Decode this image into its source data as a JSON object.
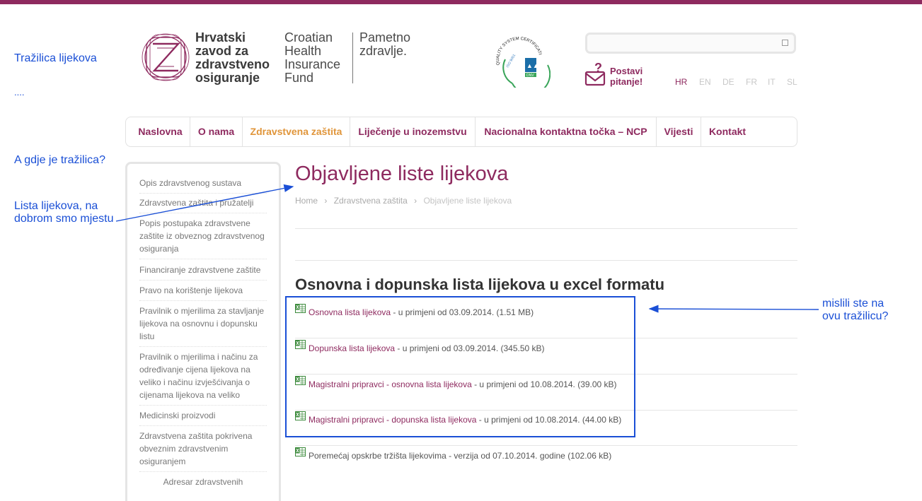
{
  "annotations": {
    "search_label": "Tražilica lijekova",
    "dots": "....",
    "where_search": "A gdje je tražilica?",
    "list_line1": "Lista lijekova, na",
    "list_line2": "dobrom smo mjestu",
    "meant_line1": "mislili ste na",
    "meant_line2": "ovu tražilicu?"
  },
  "logo": {
    "hr_lines": [
      "Hrvatski",
      "zavod za",
      "zdravstveno",
      "osiguranje"
    ],
    "en_lines": [
      "Croatian",
      "Health",
      "Insurance",
      "Fund"
    ],
    "slogan_lines": [
      "Pametno",
      "zdravlje."
    ]
  },
  "certificate": {
    "text_top": "QUALITY SYSTEM CERTIFICATION",
    "text_iso": "ISO 9001",
    "text_dnv": "DNV"
  },
  "search": {
    "value": "",
    "placeholder": ""
  },
  "ask": {
    "line1": "Postavi",
    "line2": "pitanje!"
  },
  "languages": [
    "HR",
    "EN",
    "DE",
    "FR",
    "IT",
    "SL"
  ],
  "nav": [
    "Naslovna",
    "O nama",
    "Zdravstvena zaštita",
    "Liječenje u inozemstvu",
    "Nacionalna kontaktna točka – NCP",
    "Vijesti",
    "Kontakt"
  ],
  "sidebar": [
    [
      "Opis zdravstvenog sustava"
    ],
    [
      "Zdravstvena zaštita i pružatelji"
    ],
    [
      "Popis postupaka zdravstvene",
      "zaštite iz obveznog zdravstvenog",
      "osiguranja"
    ],
    [
      "Financiranje zdravstvene zaštite"
    ],
    [
      "Pravo na korištenje lijekova"
    ],
    [
      "Pravilnik o mjerilima za stavljanje",
      "lijekova na osnovnu i dopunsku",
      "listu"
    ],
    [
      "Pravilnik o mjerilima i načinu za",
      "određivanje cijena lijekova na",
      "veliko i načinu izvješćivanja o",
      "cijenama lijekova na veliko"
    ],
    [
      "Medicinski proizvodi"
    ],
    [
      "Zdravstvena zaštita pokrivena",
      "obveznim zdravstvenim",
      "osiguranjem"
    ],
    [
      "Adresar zdravstvenih"
    ]
  ],
  "main": {
    "title": "Objavljene liste lijekova",
    "breadcrumb": [
      "Home",
      "Zdravstvena zaštita",
      "Objavljene liste lijekova"
    ],
    "breadcrumb_sep": "›",
    "section_title": "Osnovna i dopunska lista lijekova u excel formatu",
    "files": [
      {
        "link": "Osnovna lista lijekova",
        "rest": " - u primjeni od 03.09.2014. (1.51 MB)"
      },
      {
        "link": "Dopunska lista lijekova",
        "rest": " - u primjeni od 03.09.2014. (345.50 kB)"
      },
      {
        "link": "Magistralni pripravci - osnovna lista lijekova",
        "rest": " - u primjeni od 10.08.2014. (39.00 kB)"
      },
      {
        "link": "Magistralni pripravci - dopunska lista lijekova",
        "rest": " - u primjeni od 10.08.2014. (44.00 kB)"
      },
      {
        "link": "",
        "rest": "Poremećaj opskrbe tržišta lijekovima - verzija od 07.10.2014. godine (102.06 kB)"
      }
    ]
  },
  "colors": {
    "brand": "#8e2a5f",
    "nav_active": "#e0953a",
    "annotation": "#1a4fd6"
  }
}
